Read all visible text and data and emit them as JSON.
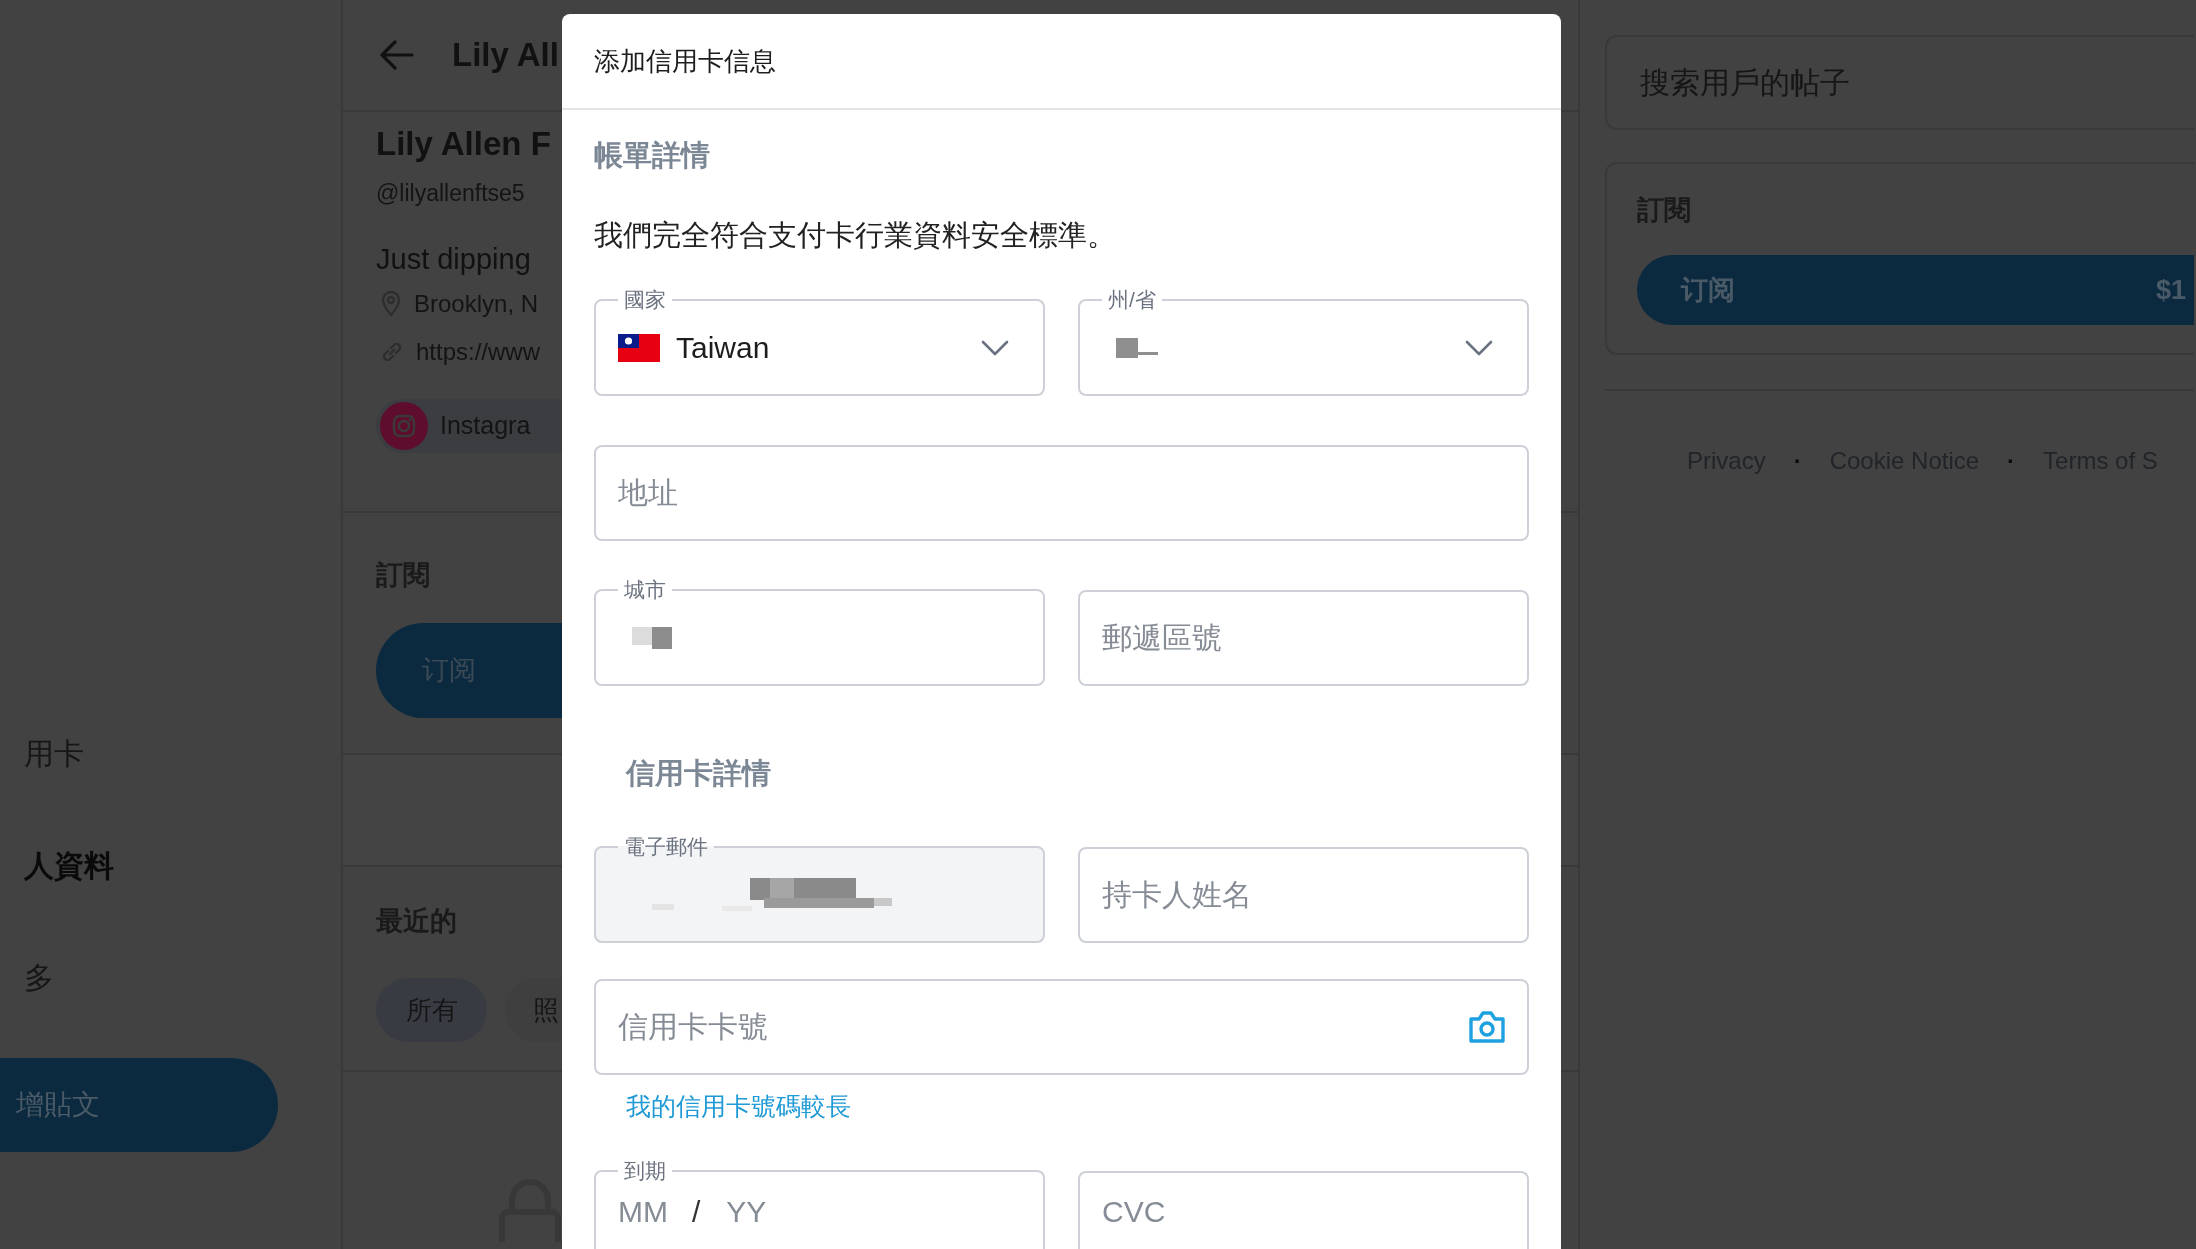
{
  "sidebar": {
    "items": [
      {
        "label": "用卡",
        "selected": false
      },
      {
        "label": "人資料",
        "selected": true
      },
      {
        "label": "多",
        "selected": false
      }
    ],
    "post_button": "增貼文"
  },
  "profile": {
    "header_title": "Lily All",
    "name": "Lily Allen F",
    "handle": "@lilyallenftse5",
    "bio": "Just dipping",
    "location": "Brooklyn, N",
    "website": "https://www",
    "social": "Instagra",
    "subscribe_heading": "訂閱",
    "subscribe_button": "订阅",
    "recent_heading": "最近的",
    "filters": [
      {
        "label": "所有",
        "selected": true
      },
      {
        "label": "照",
        "selected": false
      }
    ]
  },
  "right_panel": {
    "search": {
      "placeholder": "搜索用戶的帖子"
    },
    "subscription": {
      "heading": "訂閱",
      "button": "订阅",
      "price": "$1"
    },
    "footer": [
      {
        "kind": "link",
        "text": "Privacy"
      },
      {
        "kind": "separator",
        "text": "·"
      },
      {
        "kind": "link",
        "text": "Cookie Notice"
      },
      {
        "kind": "separator",
        "text": "·"
      },
      {
        "kind": "link",
        "text": "Terms of S"
      }
    ]
  },
  "modal": {
    "title": "添加信用卡信息",
    "billing_heading": "帳單詳情",
    "notice": "我們完全符合支付卡行業資料安全標準。",
    "billing_rows": [
      [
        {
          "kind": "select",
          "label": "國家",
          "value": "Taiwan",
          "flag": true
        },
        {
          "kind": "select",
          "label": "州/省",
          "redacted": true
        }
      ],
      [
        {
          "kind": "text",
          "placeholder": "地址"
        }
      ],
      [
        {
          "kind": "text",
          "label": "城市",
          "redacted": true
        },
        {
          "kind": "text",
          "placeholder": "郵遞區號"
        }
      ]
    ],
    "card_heading": "信用卡詳情",
    "card_rows": [
      [
        {
          "kind": "text",
          "label": "電子郵件",
          "redacted": true,
          "disabled": true
        },
        {
          "kind": "text",
          "placeholder": "持卡人姓名"
        }
      ],
      [
        {
          "kind": "text",
          "placeholder": "信用卡卡號",
          "camera": true
        }
      ]
    ],
    "long_number_link": "我的信用卡號碼較長",
    "expiry_rows": [
      [
        {
          "kind": "expiry",
          "label": "到期",
          "placeholder_parts": [
            "MM",
            "/",
            "YY"
          ]
        },
        {
          "kind": "text",
          "placeholder": "CVC"
        }
      ]
    ]
  }
}
